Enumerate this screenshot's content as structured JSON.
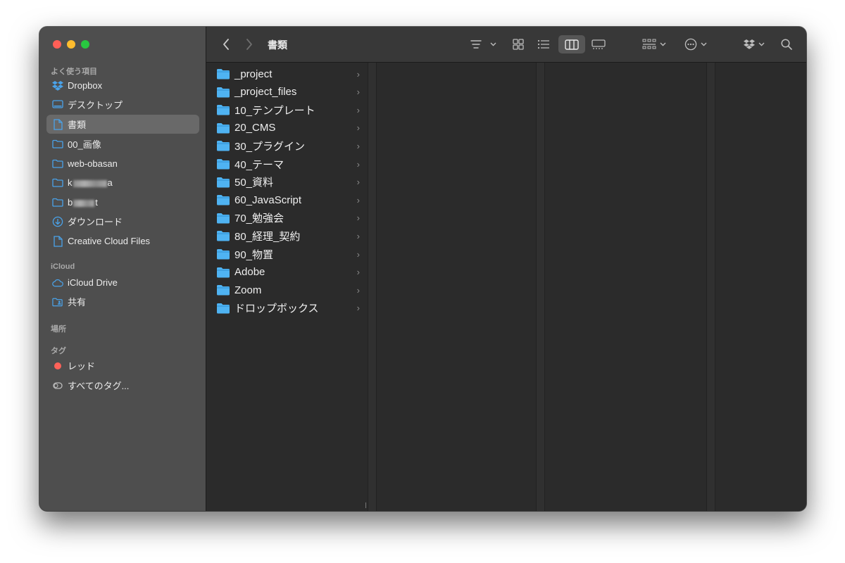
{
  "window": {
    "title": "書類"
  },
  "sidebar": {
    "favorites_title": "よく使う項目",
    "favorites": [
      {
        "label": "Dropbox",
        "icon": "dropbox-icon"
      },
      {
        "label": "デスクトップ",
        "icon": "desktop-icon"
      },
      {
        "label": "書類",
        "icon": "document-icon",
        "selected": true
      },
      {
        "label": "00_画像",
        "icon": "folder-icon"
      },
      {
        "label": "web-obasan",
        "icon": "folder-icon"
      },
      {
        "label_prefix": "k",
        "label_suffix": "a",
        "icon": "folder-icon",
        "redacted": true
      },
      {
        "label_prefix": "b",
        "label_suffix": "t",
        "icon": "folder-icon",
        "redacted": true
      },
      {
        "label": "ダウンロード",
        "icon": "download-icon"
      },
      {
        "label": "Creative Cloud Files",
        "icon": "document-icon"
      }
    ],
    "icloud_title": "iCloud",
    "icloud": [
      {
        "label": "iCloud Drive",
        "icon": "cloud-icon"
      },
      {
        "label": "共有",
        "icon": "shared-folder-icon"
      }
    ],
    "locations_title": "場所",
    "tags_title": "タグ",
    "tags": [
      {
        "label": "レッド",
        "color": "#ff6259"
      },
      {
        "label": "すべてのタグ...",
        "icon": "all-tags-icon"
      }
    ]
  },
  "columns": [
    {
      "items": [
        "_project",
        "_project_files",
        "10_テンプレート",
        "20_CMS",
        "30_プラグイン",
        "40_テーマ",
        "50_資料",
        "60_JavaScript",
        "70_勉強会",
        "80_経理_契約",
        "90_物置",
        "Adobe",
        "Zoom",
        "ドロップボックス"
      ]
    }
  ],
  "colors": {
    "folder": "#4fb3f2",
    "selection": "#696969"
  }
}
